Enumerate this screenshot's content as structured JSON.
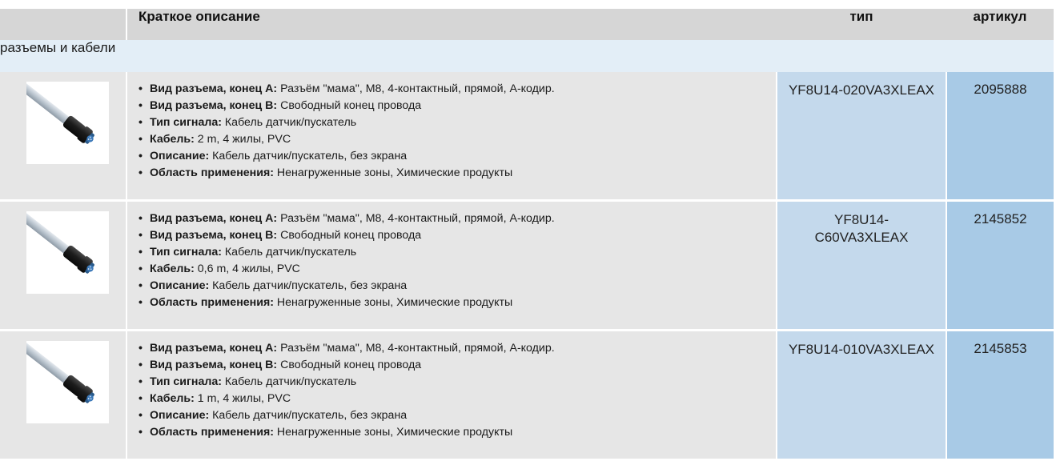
{
  "header": {
    "description": "Краткое описание",
    "type": "тип",
    "article": "артикул"
  },
  "group": {
    "title": "разъемы и кабели"
  },
  "products": [
    {
      "image_icon": "m8-female-cable-icon",
      "specs": [
        {
          "label": "Вид разъема, конец A:",
          "value": " Разъём \"мама\", M8, 4-контактный, прямой, A-кодир."
        },
        {
          "label": "Вид разъема, конец B:",
          "value": " Свободный конец провода"
        },
        {
          "label": "Тип сигнала:",
          "value": " Кабель датчик/пускатель"
        },
        {
          "label": "Кабель:",
          "value": " 2 m, 4 жилы, PVC"
        },
        {
          "label": "Описание:",
          "value": " Кабель датчик/пускатель, без экрана"
        },
        {
          "label": "Область применения:",
          "value": " Ненагруженные зоны, Химические продукты"
        }
      ],
      "type_line1": "YF8U14-020VA3XLEAX",
      "type_line2": "",
      "article": "2095888"
    },
    {
      "image_icon": "m8-female-cable-icon",
      "specs": [
        {
          "label": "Вид разъема, конец A:",
          "value": " Разъём \"мама\", M8, 4-контактный, прямой, A-кодир."
        },
        {
          "label": "Вид разъема, конец B:",
          "value": " Свободный конец провода"
        },
        {
          "label": "Тип сигнала:",
          "value": " Кабель датчик/пускатель"
        },
        {
          "label": "Кабель:",
          "value": " 0,6 m, 4 жилы, PVC"
        },
        {
          "label": "Описание:",
          "value": " Кабель датчик/пускатель, без экрана"
        },
        {
          "label": "Область применения:",
          "value": " Ненагруженные зоны, Химические продукты"
        }
      ],
      "type_line1": "YF8U14-",
      "type_line2": "C60VA3XLEAX",
      "article": "2145852"
    },
    {
      "image_icon": "m8-female-cable-icon",
      "specs": [
        {
          "label": "Вид разъема, конец A:",
          "value": " Разъём \"мама\", M8, 4-контактный, прямой, A-кодир."
        },
        {
          "label": "Вид разъема, конец B:",
          "value": " Свободный конец провода"
        },
        {
          "label": "Тип сигнала:",
          "value": " Кабель датчик/пускатель"
        },
        {
          "label": "Кабель:",
          "value": " 1 m, 4 жилы, PVC"
        },
        {
          "label": "Описание:",
          "value": " Кабель датчик/пускатель, без экрана"
        },
        {
          "label": "Область применения:",
          "value": " Ненагруженные зоны, Химические продукты"
        }
      ],
      "type_line1": "YF8U14-010VA3XLEAX",
      "type_line2": "",
      "article": "2145853"
    }
  ]
}
